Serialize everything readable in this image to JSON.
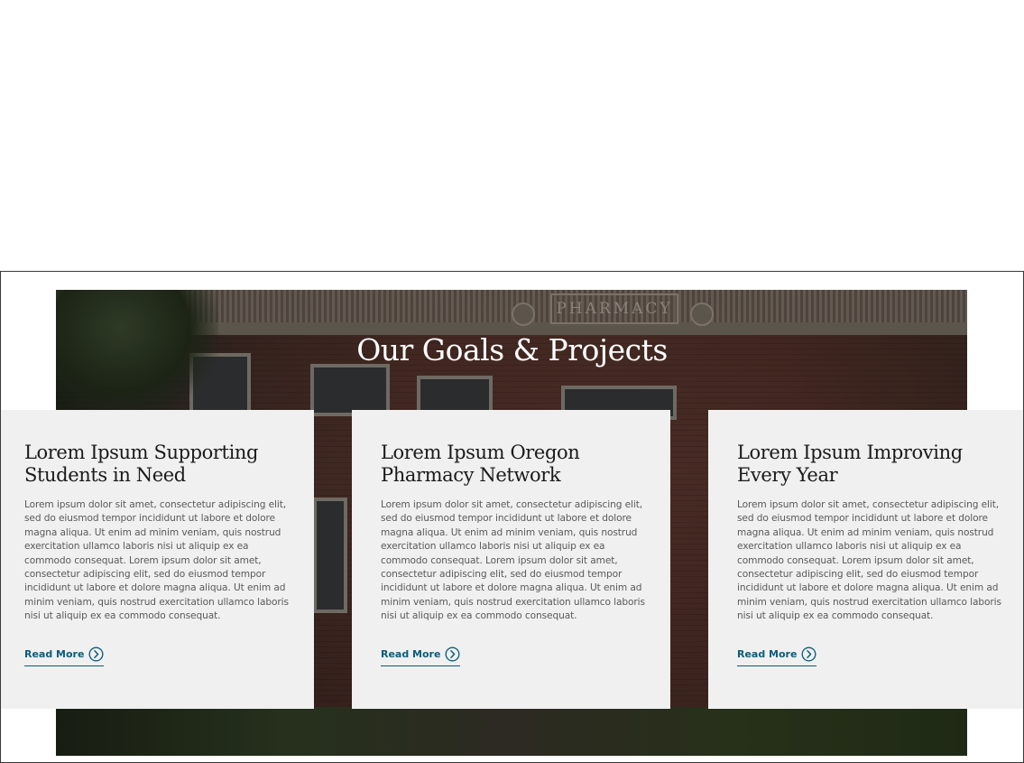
{
  "section": {
    "title": "Our Goals & Projects",
    "background_plaque": "PHARMACY"
  },
  "cards": [
    {
      "title": "Lorem Ipsum Supporting Students in Need",
      "body": "Lorem ipsum dolor sit amet, consectetur adipiscing elit, sed do eiusmod tempor incididunt ut labore et dolore magna aliqua. Ut enim ad minim veniam, quis nostrud exercitation ullamco laboris nisi ut aliquip ex ea commodo consequat. Lorem ipsum dolor sit amet, consectetur adipiscing elit, sed do eiusmod tempor incididunt ut labore et dolore magna aliqua. Ut enim ad minim veniam, quis nostrud exercitation ullamco laboris nisi ut aliquip ex ea commodo consequat.",
      "link_label": "Read More",
      "link_icon": "chevron-right-circle-icon"
    },
    {
      "title": "Lorem Ipsum Oregon Pharmacy Network",
      "body": "Lorem ipsum dolor sit amet, consectetur adipiscing elit, sed do eiusmod tempor incididunt ut labore et dolore magna aliqua. Ut enim ad minim veniam, quis nostrud exercitation ullamco laboris nisi ut aliquip ex ea commodo consequat. Lorem ipsum dolor sit amet, consectetur adipiscing elit, sed do eiusmod tempor incididunt ut labore et dolore magna aliqua. Ut enim ad minim veniam, quis nostrud exercitation ullamco laboris nisi ut aliquip ex ea commodo consequat.",
      "link_label": "Read More",
      "link_icon": "chevron-right-circle-icon"
    },
    {
      "title": "Lorem Ipsum Improving Every Year",
      "body": "Lorem ipsum dolor sit amet, consectetur adipiscing elit, sed do eiusmod tempor incididunt ut labore et dolore magna aliqua. Ut enim ad minim veniam, quis nostrud exercitation ullamco laboris nisi ut aliquip ex ea commodo consequat. Lorem ipsum dolor sit amet, consectetur adipiscing elit, sed do eiusmod tempor incididunt ut labore et dolore magna aliqua. Ut enim ad minim veniam, quis nostrud exercitation ullamco laboris nisi ut aliquip ex ea commodo consequat.",
      "link_label": "Read More",
      "link_icon": "chevron-right-circle-icon"
    }
  ],
  "colors": {
    "link": "#0a5d7a",
    "card_background": "#f0f0f0",
    "title_text": "#ffffff"
  }
}
